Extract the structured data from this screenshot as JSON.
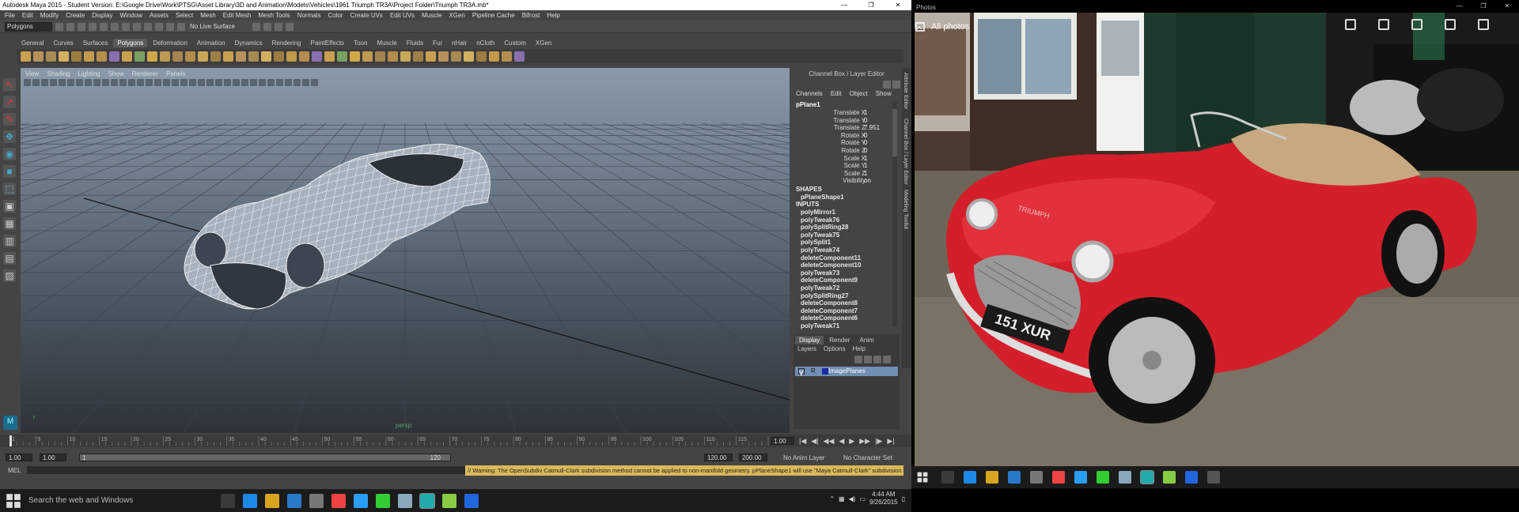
{
  "maya": {
    "title": "Autodesk Maya 2015 - Student Version: E:\\Google Drive\\Work\\PTSG\\Asset Library\\3D and Animation\\Models\\Vehicles\\1961 Triumph TR3A\\Project Folder\\Triumph TR3A.mb*",
    "window_controls": [
      "—",
      "❐",
      "✕"
    ],
    "menus": [
      "File",
      "Edit",
      "Modify",
      "Create",
      "Display",
      "Window",
      "Assets",
      "Select",
      "Mesh",
      "Edit Mesh",
      "Mesh Tools",
      "Normals",
      "Color",
      "Create UVs",
      "Edit UVs",
      "Muscle",
      "XGen",
      "Pipeline Cache",
      "Bifrost",
      "Help"
    ],
    "mode": "Polygons",
    "live_surface": "No Live Surface",
    "shelf_tabs": [
      "General",
      "Curves",
      "Surfaces",
      "Polygons",
      "Deformation",
      "Animation",
      "Dynamics",
      "Rendering",
      "PaintEffects",
      "Toon",
      "Muscle",
      "Fluids",
      "Fur",
      "nHair",
      "nCloth",
      "Custom",
      "XGen"
    ],
    "active_shelf": "Polygons",
    "viewport_menu": [
      "View",
      "Shading",
      "Lighting",
      "Show",
      "Renderer",
      "Panels"
    ],
    "grid_label": "persp",
    "channel_box": {
      "header": "Channel Box / Layer Editor",
      "tabs": [
        "Channels",
        "Edit",
        "Object",
        "Show"
      ],
      "object": "pPlane1",
      "attributes": [
        {
          "name": "Translate X",
          "value": "1"
        },
        {
          "name": "Translate Y",
          "value": "0"
        },
        {
          "name": "Translate Z",
          "value": "7.951"
        },
        {
          "name": "Rotate X",
          "value": "0"
        },
        {
          "name": "Rotate Y",
          "value": "0"
        },
        {
          "name": "Rotate Z",
          "value": "0"
        },
        {
          "name": "Scale X",
          "value": "1"
        },
        {
          "name": "Scale Y",
          "value": "1"
        },
        {
          "name": "Scale Z",
          "value": "1"
        },
        {
          "name": "Visibility",
          "value": "on"
        }
      ],
      "shapes_label": "SHAPES",
      "shape": "pPlaneShape1",
      "inputs_label": "INPUTS",
      "inputs": [
        "polyMirror1",
        "polyTweak76",
        "polySplitRing28",
        "polyTweak75",
        "polySplit1",
        "polyTweak74",
        "deleteComponent11",
        "deleteComponent10",
        "polyTweak73",
        "deleteComponent9",
        "polyTweak72",
        "polySplitRing27",
        "deleteComponent8",
        "deleteComponent7",
        "deleteComponent6",
        "polyTweak71"
      ]
    },
    "side_tabs": [
      "Attribute Editor",
      "Channel Box / Layer Editor",
      "Modeling Toolkit"
    ],
    "layer_editor": {
      "tabs": [
        "Display",
        "Render",
        "Anim"
      ],
      "sub_menu": [
        "Layers",
        "Options",
        "Help"
      ],
      "layer_v": "V",
      "layer_r": "R",
      "layer_name": "ImagePlanes"
    },
    "timeline": {
      "ticks": [
        "1",
        "5",
        "10",
        "15",
        "20",
        "25",
        "30",
        "35",
        "40",
        "45",
        "50",
        "55",
        "60",
        "65",
        "70",
        "75",
        "80",
        "85",
        "90",
        "95",
        "100",
        "105",
        "110",
        "115",
        "120"
      ],
      "current_frame": "1.00"
    },
    "range": {
      "start": "1.00",
      "start2": "1.00",
      "slider_start": "1",
      "slider_end": "120",
      "end": "120.00",
      "end2": "200.00",
      "anim_layer": "No Anim Layer",
      "character_set": "No Character Set"
    },
    "command": {
      "mel_label": "MEL",
      "warning": "// Warning: The OpenSubdiv Catmull-Clark subdivision method cannot be applied to non-manifold geometry. pPlaneShape1 will use \"Maya Catmull-Clark\" subdivision method for Smooth Mesh P"
    },
    "taskbar": {
      "search": "Search the web and Windows",
      "time": "4:44 AM",
      "date": "9/26/2015"
    }
  },
  "photos": {
    "title": "Photos",
    "window_controls": [
      "—",
      "❐",
      "✕"
    ],
    "back_label": "All photos",
    "actions": [
      "share-icon",
      "slideshow-icon",
      "edit-icon",
      "rotate-icon",
      "delete-icon"
    ],
    "plate": "151 XUR",
    "badge": "TRIUMPH"
  }
}
